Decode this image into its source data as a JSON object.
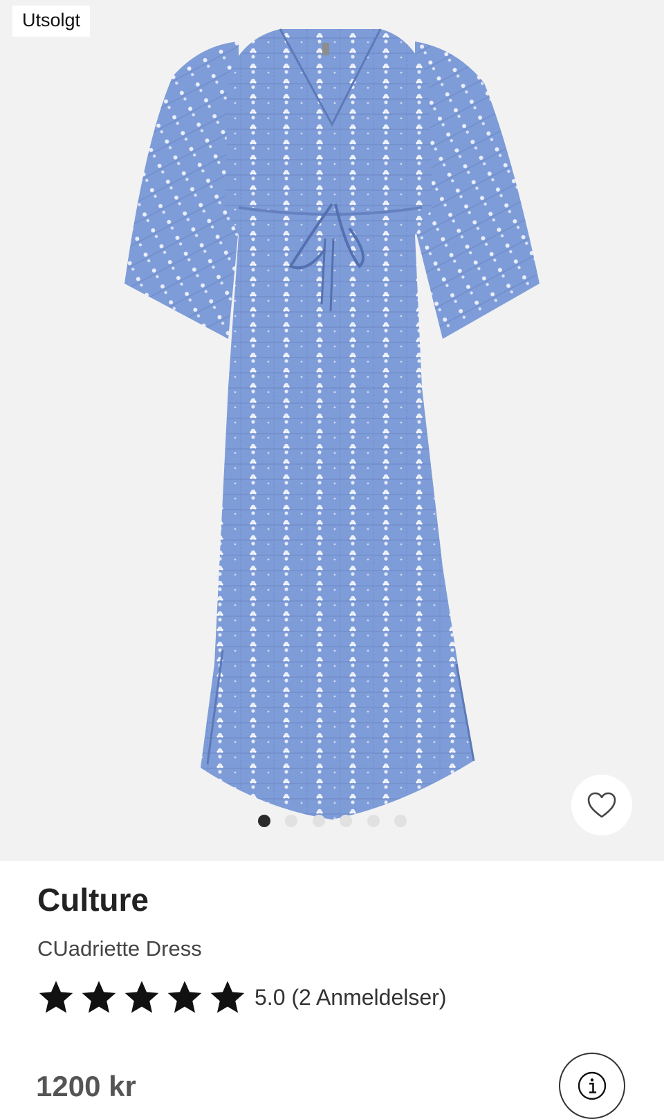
{
  "gallery": {
    "badge": "Utsolgt",
    "image_icon": "blue-dress-image",
    "slide_count": 6,
    "active_slide": 1,
    "favorite_icon": "heart-outline-icon"
  },
  "product": {
    "brand": "Culture",
    "name": "CUadriette Dress",
    "rating_icon": "star-icon",
    "rating_value": 5,
    "rating_text": "5.0 (2 Anmeldelser)",
    "price": "1200 kr",
    "info_icon": "info-icon"
  },
  "colors": {
    "dress_blue": "#7d9ad6",
    "gallery_bg": "#f2f2f2",
    "active_dot": "#2a2a2a",
    "star": "#111111"
  }
}
